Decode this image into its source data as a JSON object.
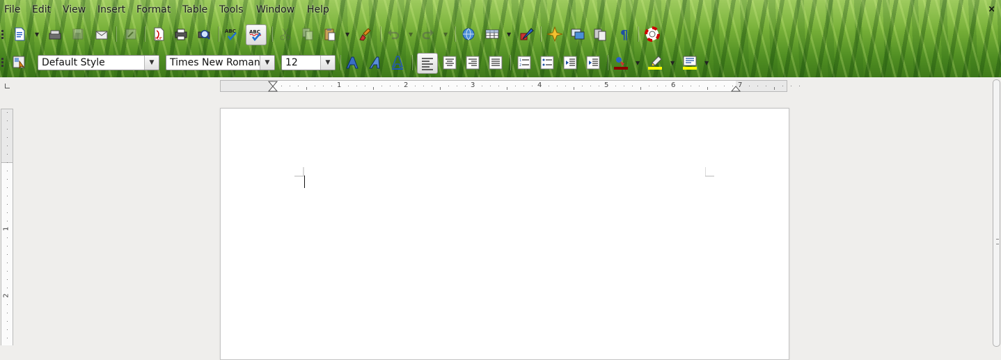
{
  "menubar": {
    "items": [
      "File",
      "Edit",
      "View",
      "Insert",
      "Format",
      "Table",
      "Tools",
      "Window",
      "Help"
    ],
    "close_glyph": "×"
  },
  "toolbar_standard": {
    "icons": [
      "new-document-icon",
      "open-icon",
      "save-icon",
      "email-icon",
      "edit-file-icon",
      "export-pdf-icon",
      "print-icon",
      "print-preview-icon",
      "spellcheck-icon",
      "autospellcheck-icon",
      "cut-icon",
      "copy-icon",
      "paste-icon",
      "clone-formatting-icon",
      "undo-icon",
      "redo-icon",
      "hyperlink-icon",
      "table-icon",
      "show-draw-functions-icon",
      "navigator-icon",
      "gallery-icon",
      "data-sources-icon",
      "formatting-marks-icon",
      "help-icon"
    ]
  },
  "toolbar_formatting": {
    "paragraph_style": "Default Style",
    "font_name": "Times New Roman",
    "font_size": "12"
  },
  "ruler": {
    "h_numbers": [
      "1",
      "2",
      "3",
      "4",
      "5",
      "6",
      "7"
    ],
    "v_numbers": [
      "1",
      "2"
    ]
  },
  "colors": {
    "font_color": "#8b0000",
    "highlight": "#ffff00",
    "background": "#ffff00"
  }
}
